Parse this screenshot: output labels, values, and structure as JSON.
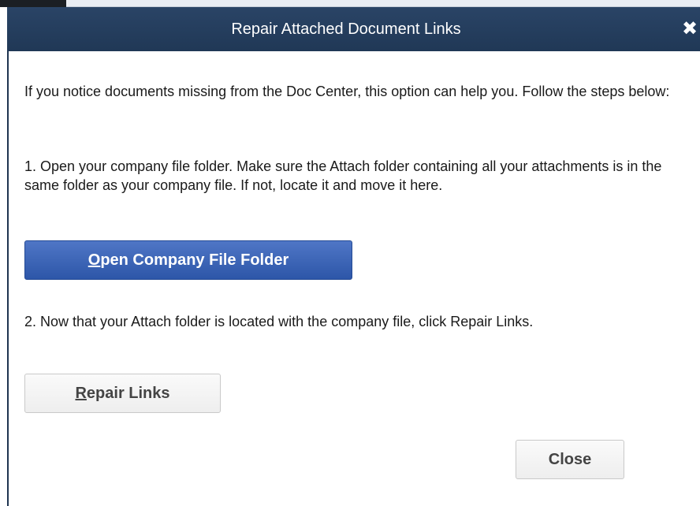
{
  "dialog": {
    "title": "Repair Attached Document Links",
    "close_icon": "close-icon",
    "close_glyph": "✖"
  },
  "content": {
    "intro": "If you notice documents missing from the Doc Center, this option can help you. Follow the steps below:",
    "step1": "1. Open your company file folder. Make sure the Attach folder containing all your attachments is in the same folder as your company file. If not, locate it and move it here.",
    "step2": "2. Now that your Attach folder is located with the company file, click Repair Links."
  },
  "buttons": {
    "open_folder": {
      "mnemonic": "O",
      "rest": "pen Company File Folder"
    },
    "repair_links": {
      "mnemonic": "R",
      "rest": "epair Links"
    },
    "close": "Close"
  },
  "colors": {
    "titlebar": "#203856",
    "primary_button": "#2d56a8",
    "text": "#1a1a1a"
  }
}
